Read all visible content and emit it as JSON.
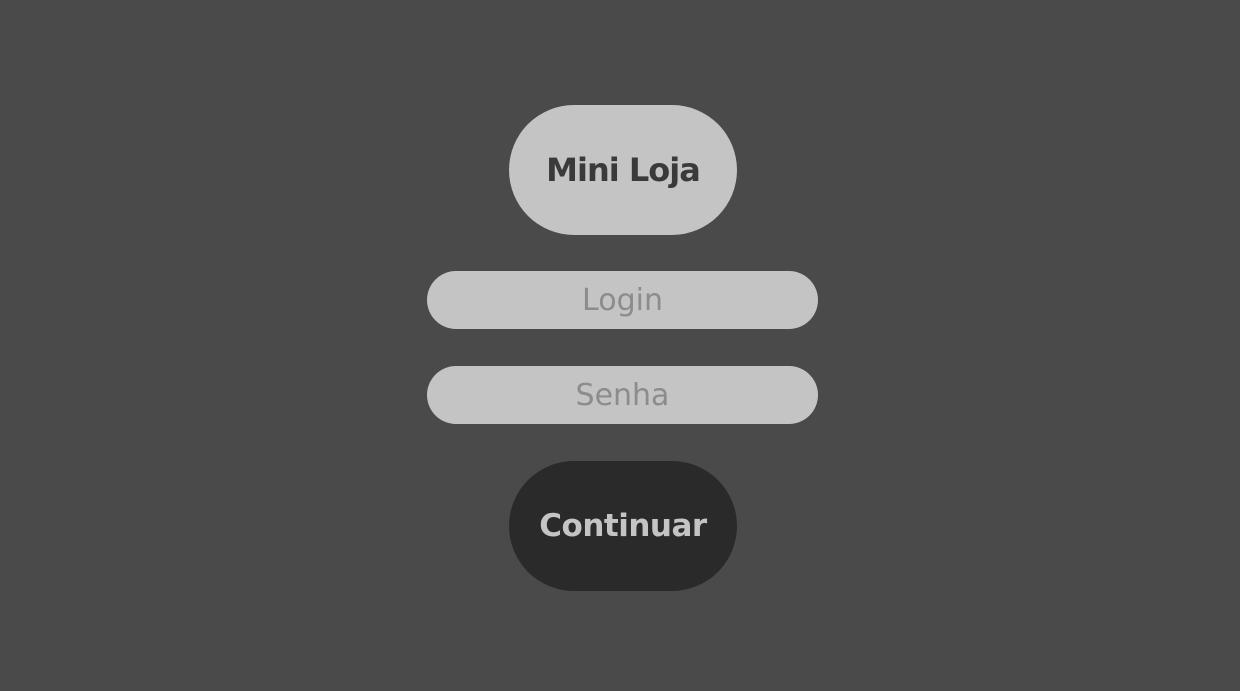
{
  "logo": {
    "text": "Mini Loja"
  },
  "login_form": {
    "login_field": {
      "placeholder": "Login",
      "value": ""
    },
    "password_field": {
      "placeholder": "Senha",
      "value": ""
    },
    "continue_label": "Continuar"
  },
  "colors": {
    "background": "#4a4a4a",
    "pill_light": "#c4c4c4",
    "button_dark": "#2a2a2a",
    "text_dark": "#3a3a3a",
    "placeholder": "#8c8c8c"
  }
}
